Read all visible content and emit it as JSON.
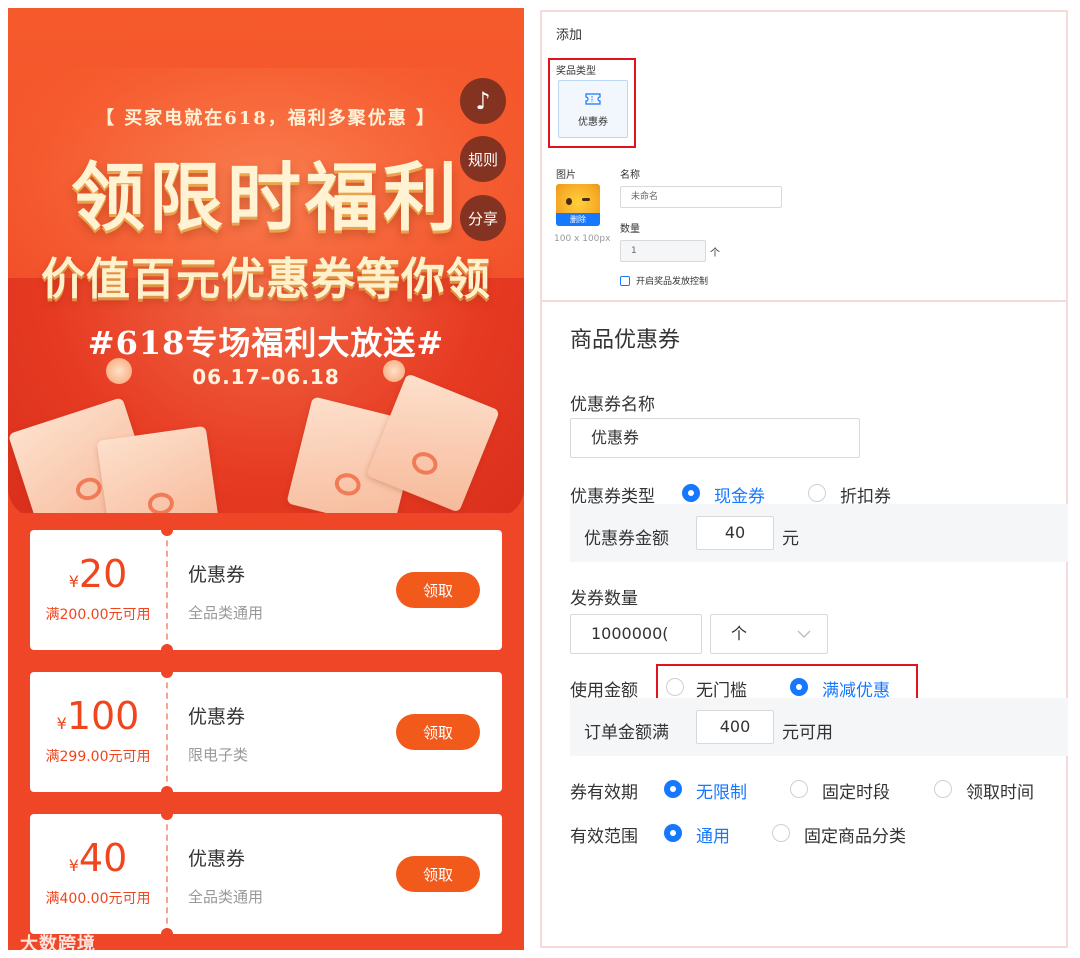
{
  "preview": {
    "float_buttons": {
      "music_icon": "music-note-icon",
      "rules": "规则",
      "share": "分享"
    },
    "banner": {
      "top_line": "【 买家电就在618，福利多聚优惠 】",
      "headline": "领限时福利",
      "subheadline": "价值百元优惠券等你领",
      "tag": "#618专场福利大放送#",
      "date": "06.17–06.18"
    },
    "coupons": [
      {
        "currency": "¥",
        "amount": "20",
        "condition": "满200.00元可用",
        "title": "优惠券",
        "scope": "全品类通用",
        "button": "领取"
      },
      {
        "currency": "¥",
        "amount": "100",
        "condition": "满299.00元可用",
        "title": "优惠券",
        "scope": "限电子类",
        "button": "领取"
      },
      {
        "currency": "¥",
        "amount": "40",
        "condition": "满400.00元可用",
        "title": "优惠券",
        "scope": "全品类通用",
        "button": "领取"
      }
    ],
    "watermark": "大数跨境"
  },
  "add_panel": {
    "title": "添加",
    "prize_type_label": "奖品类型",
    "prize_type_option": {
      "icon": "ticket-icon",
      "label": "优惠券"
    },
    "image_label": "图片",
    "image_delete": "删除",
    "image_size_hint": "100 x 100px",
    "name_label": "名称",
    "name_value": "未命名",
    "quantity_label": "数量",
    "quantity_value": "1",
    "quantity_unit": "个",
    "issue_control_label": "开启奖品发放控制"
  },
  "coupon_form": {
    "section_title": "商品优惠券",
    "name_label": "优惠券名称",
    "name_value": "优惠券",
    "type_label": "优惠券类型",
    "type_options": [
      "现金券",
      "折扣券"
    ],
    "type_selected": "现金券",
    "amount_label": "优惠券金额",
    "amount_value": "40",
    "amount_unit": "元",
    "issue_qty_label": "发券数量",
    "issue_qty_value": "1000000(",
    "issue_qty_unit": "个",
    "usage_label": "使用金额",
    "usage_options": [
      "无门槛",
      "满减优惠"
    ],
    "usage_selected": "满减优惠",
    "threshold_label": "订单金额满",
    "threshold_value": "400",
    "threshold_unit": "元可用",
    "validity_label": "券有效期",
    "validity_options": [
      "无限制",
      "固定时段",
      "领取时间"
    ],
    "validity_selected": "无限制",
    "scope_label": "有效范围",
    "scope_options": [
      "通用",
      "固定商品分类"
    ],
    "scope_selected": "通用"
  },
  "colors": {
    "accent": "#1677ff",
    "brand": "#f0461e",
    "highlight": "#e0141e"
  }
}
